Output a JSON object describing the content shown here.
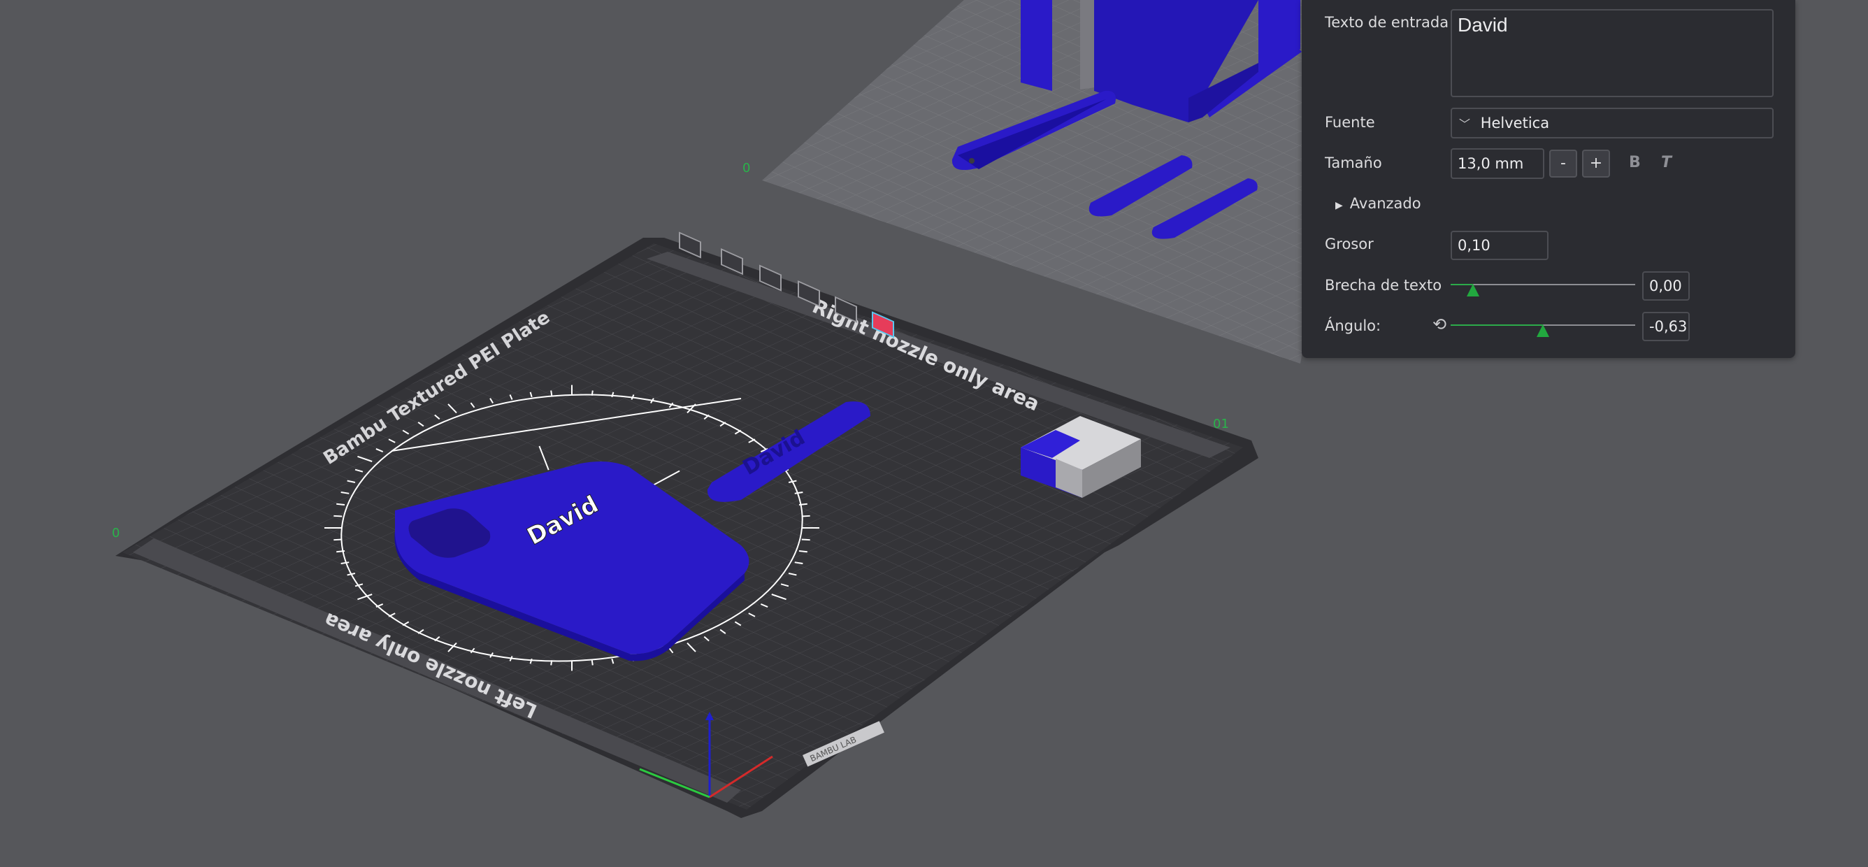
{
  "viewport": {
    "plate_name": "Bambu Textured PEI Plate",
    "right_area_label": "Right nozzle only area",
    "left_area_label": "Left nozzle only area",
    "plate_index_top": "0",
    "plate_index_left": "0",
    "plate_index_right": "01",
    "phone_case_text": "David",
    "keychain_text": "David",
    "brand_mark": "BAMBU LAB"
  },
  "text_panel": {
    "input_label": "Texto de entrada",
    "input_value": "David",
    "font_label": "Fuente",
    "font_value": "Helvetica",
    "size_label": "Tamaño",
    "size_value": "13,0 mm",
    "minus_label": "-",
    "plus_label": "+",
    "bold_label": "B",
    "italic_label": "T",
    "advanced_label": "Avanzado",
    "thickness_label": "Grosor",
    "thickness_value": "0,10",
    "gap_label": "Brecha de texto",
    "gap_value": "0,00",
    "gap_fraction": 0.12,
    "angle_label": "Ángulo:",
    "angle_value": "-0,63",
    "angle_fraction": 0.5
  },
  "colors": {
    "background": "#56575b",
    "plate": "#343438",
    "model_blue": "#2a1ac8",
    "accent_green": "#22a83f",
    "panel": "#2b2c31"
  }
}
